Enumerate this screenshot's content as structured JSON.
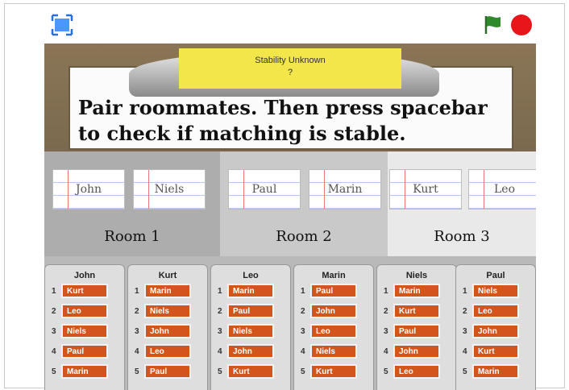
{
  "status": {
    "title": "Stability Unknown",
    "value": "?"
  },
  "instruction": "Pair roommates. Then press spacebar to check if matching is stable.",
  "colors": {
    "stop": "#e8151b",
    "flag": "#2f8a2c",
    "chip": "#d2561c",
    "status_bg": "#f2e64a"
  },
  "icons": {
    "fullscreen": "fullscreen-icon",
    "flag": "green-flag-icon",
    "stop": "stop-icon"
  },
  "rooms": [
    {
      "label": "Room 1",
      "occupants": [
        "John",
        "Niels"
      ]
    },
    {
      "label": "Room 2",
      "occupants": [
        "Paul",
        "Marin"
      ]
    },
    {
      "label": "Room 3",
      "occupants": [
        "Kurt",
        "Leo"
      ]
    }
  ],
  "people": [
    {
      "name": "John",
      "prefs": [
        "Kurt",
        "Leo",
        "Niels",
        "Paul",
        "Marin"
      ]
    },
    {
      "name": "Kurt",
      "prefs": [
        "Marin",
        "Niels",
        "John",
        "Leo",
        "Paul"
      ]
    },
    {
      "name": "Leo",
      "prefs": [
        "Marin",
        "Paul",
        "Niels",
        "John",
        "Kurt"
      ]
    },
    {
      "name": "Marin",
      "prefs": [
        "Paul",
        "John",
        "Leo",
        "Niels",
        "Kurt"
      ]
    },
    {
      "name": "Niels",
      "prefs": [
        "Marin",
        "Kurt",
        "Paul",
        "John",
        "Leo"
      ]
    },
    {
      "name": "Paul",
      "prefs": [
        "Niels",
        "Leo",
        "John",
        "Kurt",
        "Marin"
      ]
    }
  ]
}
